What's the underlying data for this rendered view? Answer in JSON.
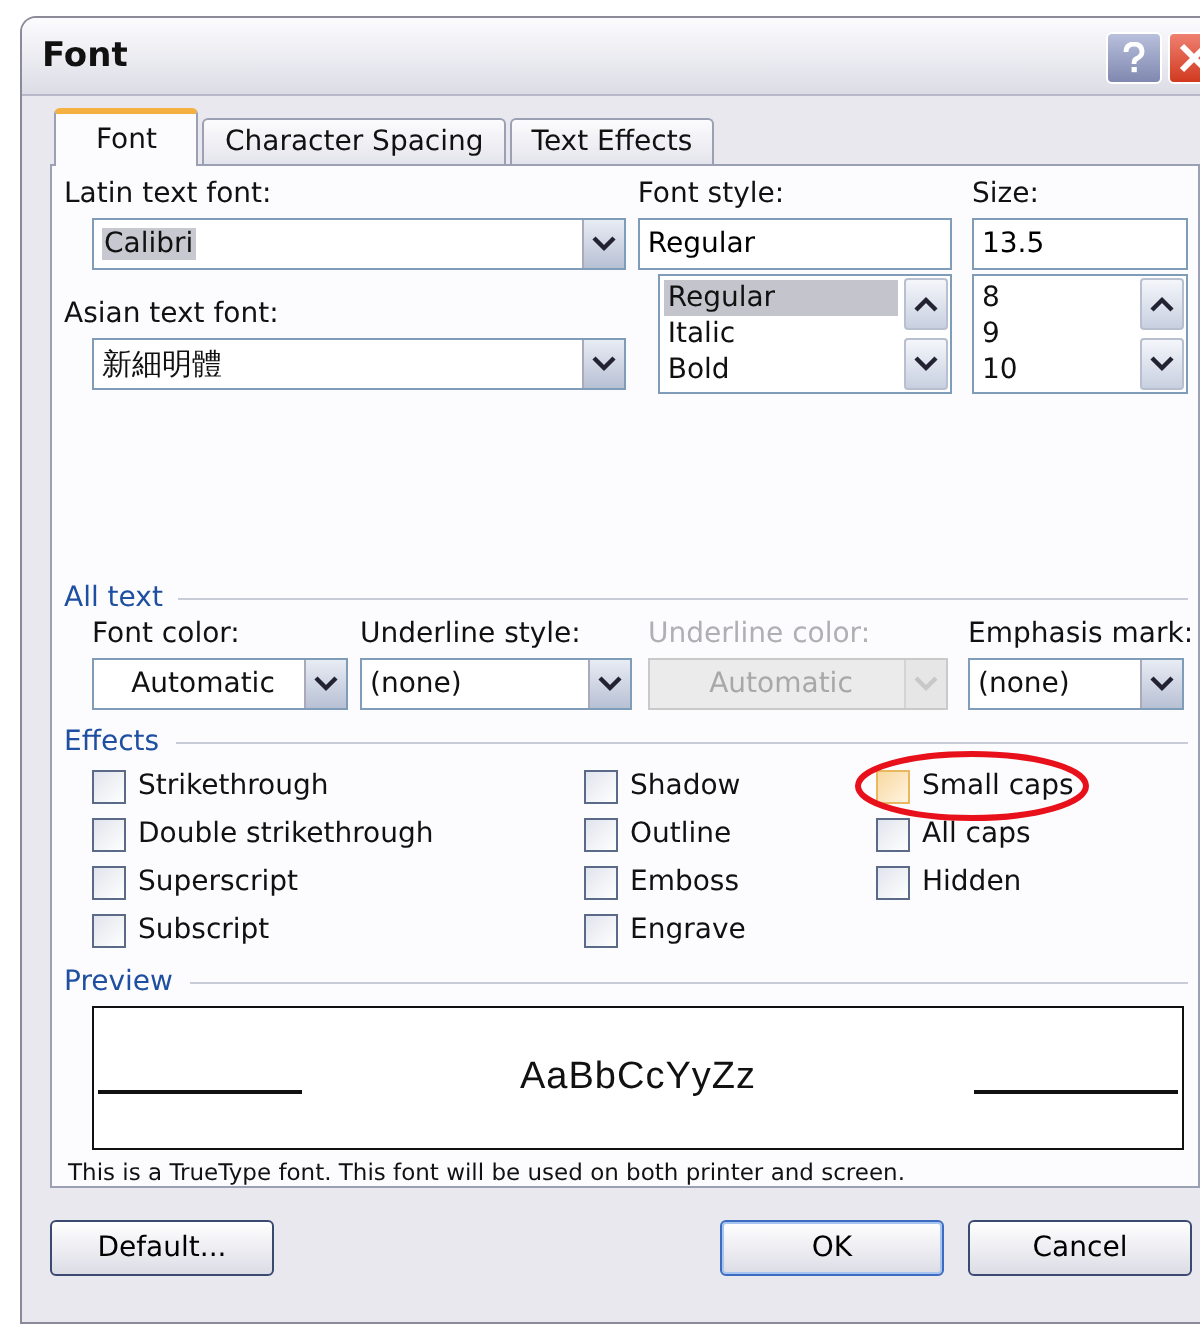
{
  "window": {
    "title": "Font"
  },
  "tabs": [
    {
      "label": "Font",
      "selected": true
    },
    {
      "label": "Character Spacing",
      "selected": false
    },
    {
      "label": "Text Effects",
      "selected": false
    }
  ],
  "latin_font": {
    "label": "Latin text font:",
    "value": "Calibri"
  },
  "asian_font": {
    "label": "Asian text font:",
    "value": "新細明體"
  },
  "font_style": {
    "label": "Font style:",
    "value": "Regular",
    "options": [
      {
        "label": "Regular",
        "selected": true
      },
      {
        "label": "Italic",
        "selected": false
      },
      {
        "label": "Bold",
        "selected": false
      }
    ]
  },
  "size": {
    "label": "Size:",
    "value": "13.5",
    "options": [
      {
        "label": "8",
        "selected": false
      },
      {
        "label": "9",
        "selected": false
      },
      {
        "label": "10",
        "selected": false
      }
    ]
  },
  "all_text": {
    "heading": "All text",
    "dropdowns": [
      {
        "label": "Font color:",
        "value": "Automatic",
        "disabled": false
      },
      {
        "label": "Underline style:",
        "value": "(none)",
        "disabled": false
      },
      {
        "label": "Underline color:",
        "value": "Automatic",
        "disabled": true
      },
      {
        "label": "Emphasis mark:",
        "value": "(none)",
        "disabled": false
      }
    ]
  },
  "effects": {
    "heading": "Effects",
    "columns": [
      [
        {
          "label": "Strikethrough",
          "checked": false,
          "circled": false
        },
        {
          "label": "Double strikethrough",
          "checked": false,
          "circled": false
        },
        {
          "label": "Superscript",
          "checked": false,
          "circled": false
        },
        {
          "label": "Subscript",
          "checked": false,
          "circled": false
        }
      ],
      [
        {
          "label": "Shadow",
          "checked": false,
          "circled": false
        },
        {
          "label": "Outline",
          "checked": false,
          "circled": false
        },
        {
          "label": "Emboss",
          "checked": false,
          "circled": false
        },
        {
          "label": "Engrave",
          "checked": false,
          "circled": false
        }
      ],
      [
        {
          "label": "Small caps",
          "checked": false,
          "circled": true
        },
        {
          "label": "All caps",
          "checked": false,
          "circled": false
        },
        {
          "label": "Hidden",
          "checked": false,
          "circled": false
        }
      ]
    ]
  },
  "preview": {
    "heading": "Preview",
    "sample": "AaBbCcYyZz"
  },
  "note": "This is a TrueType font. This font will be used on both printer and screen.",
  "buttons": [
    {
      "label": "Default...",
      "default": false
    },
    {
      "label": "OK",
      "default": true
    },
    {
      "label": "Cancel",
      "default": false
    }
  ]
}
